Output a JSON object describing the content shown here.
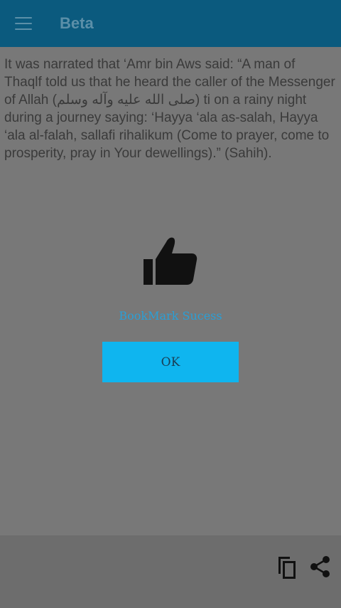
{
  "app_bar": {
    "title": "Beta",
    "menu_icon": "hamburger-menu-icon",
    "color": "#0b5a7e"
  },
  "content": {
    "text": "It was narrated that ‘Amr bin Aws said: “A man of Thaqlf told us that he heard the caller of the Messenger of Allah (صلى الله عليه وآله وسلم) ti on a rainy night during a journey saying: ‘Hayya ‘ala as-salah, Hayya ‘ala al-falah, sallafi rihalikum (Come to prayer, come to prosperity, pray in Your dewellings).” (Sahih)."
  },
  "dialog": {
    "icon": "thumbs-up-icon",
    "message": "BookMark Sucess",
    "ok_label": "OK",
    "accent": "#0fb5ef"
  },
  "bottom_bar": {
    "icons": [
      "copy-icon",
      "share-icon"
    ]
  }
}
